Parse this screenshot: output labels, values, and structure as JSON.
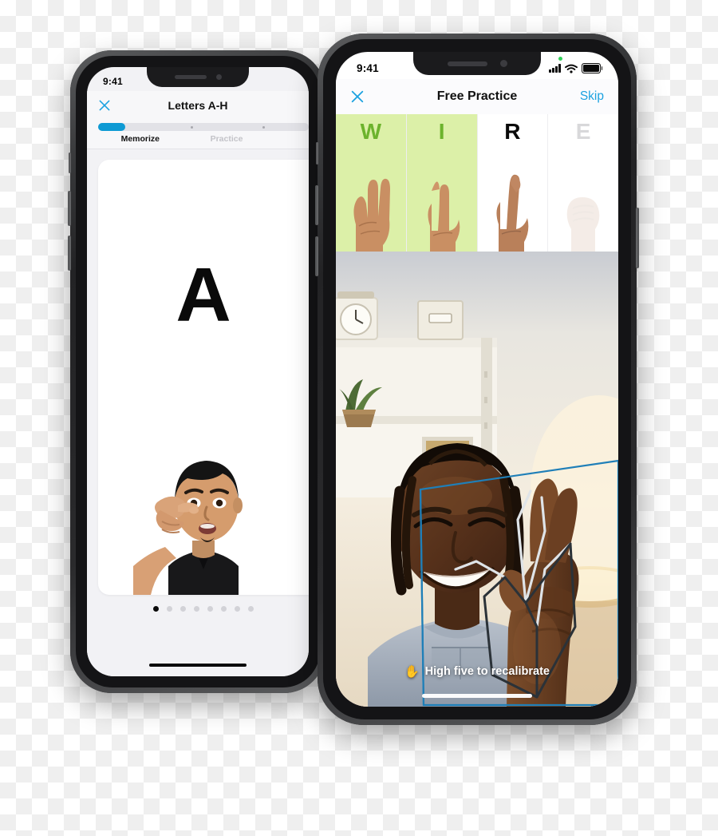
{
  "left_phone": {
    "status": {
      "time": "9:41"
    },
    "nav": {
      "close_icon": "close-x-icon",
      "title": "Letters A-H"
    },
    "progress": {
      "percent": 12,
      "marker_positions": [
        44,
        78
      ]
    },
    "tabs": [
      {
        "label": "Memorize",
        "state": "active"
      },
      {
        "label": "Practice",
        "state": "inactive"
      }
    ],
    "card": {
      "letter": "A",
      "demo_alt": "person-signing-letter-a"
    },
    "pager": {
      "count": 8,
      "active_index": 0
    },
    "home_indicator": "home-indicator"
  },
  "right_phone": {
    "status": {
      "time": "9:41",
      "recording_dot": "green-recording-dot",
      "signal_icon": "cellular-signal-icon",
      "wifi_icon": "wifi-icon",
      "battery_icon": "battery-full-icon"
    },
    "nav": {
      "close_icon": "close-x-icon",
      "title": "Free Practice",
      "skip_label": "Skip"
    },
    "letters": [
      {
        "char": "W",
        "state": "done"
      },
      {
        "char": "I",
        "state": "done"
      },
      {
        "char": "R",
        "state": "current"
      },
      {
        "char": "E",
        "state": "upcoming"
      }
    ],
    "camera": {
      "overlay_box": "hand-tracking-bounding-box",
      "skeleton": "hand-skeleton-overlay",
      "scene_alt": "front-camera-selfie-view"
    },
    "caption": {
      "icon": "raised-hand-icon",
      "icon_glyph": "✋",
      "text": "High five to recalibrate"
    },
    "home_indicator": "home-indicator"
  },
  "colors": {
    "accent_blue": "#1ca2e0",
    "progress_blue": "#0e9ad4",
    "done_bg": "#dcf0a8",
    "done_text": "#6cb32d",
    "tracking_box": "#1f7fb8",
    "recording_green": "#30d158"
  }
}
